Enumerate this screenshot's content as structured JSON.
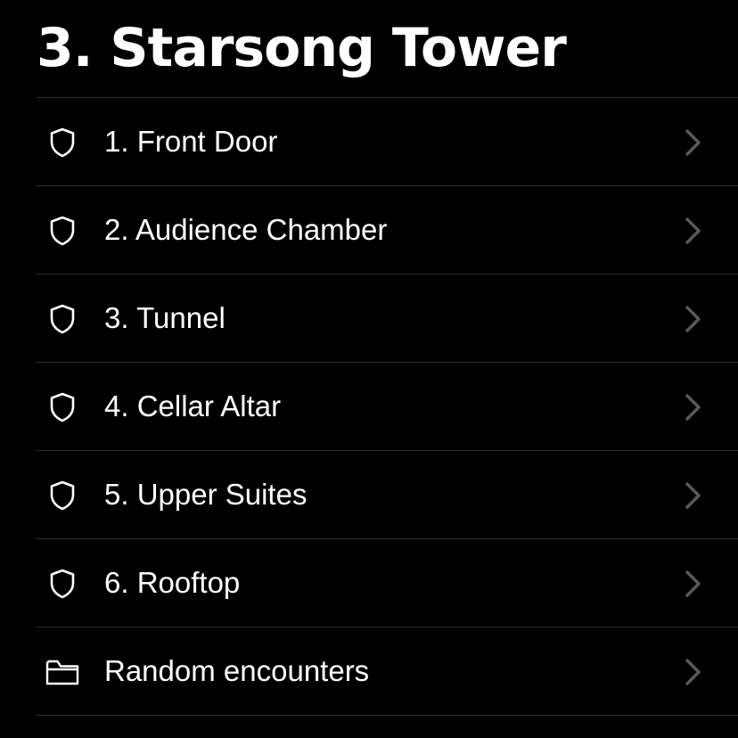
{
  "page": {
    "title": "3. Starsong Tower"
  },
  "colors": {
    "background": "#000000",
    "text": "#ffffff",
    "separator": "#2c2c2e",
    "chevron": "#5a5a5e"
  },
  "list": {
    "items": [
      {
        "label": "1. Front Door",
        "icon": "shield-icon"
      },
      {
        "label": "2. Audience Chamber",
        "icon": "shield-icon"
      },
      {
        "label": "3. Tunnel",
        "icon": "shield-icon"
      },
      {
        "label": "4. Cellar Altar",
        "icon": "shield-icon"
      },
      {
        "label": "5. Upper Suites",
        "icon": "shield-icon"
      },
      {
        "label": "6. Rooftop",
        "icon": "shield-icon"
      },
      {
        "label": "Random encounters",
        "icon": "folder-icon"
      }
    ],
    "trailing_icon": "chevron-right-icon"
  }
}
